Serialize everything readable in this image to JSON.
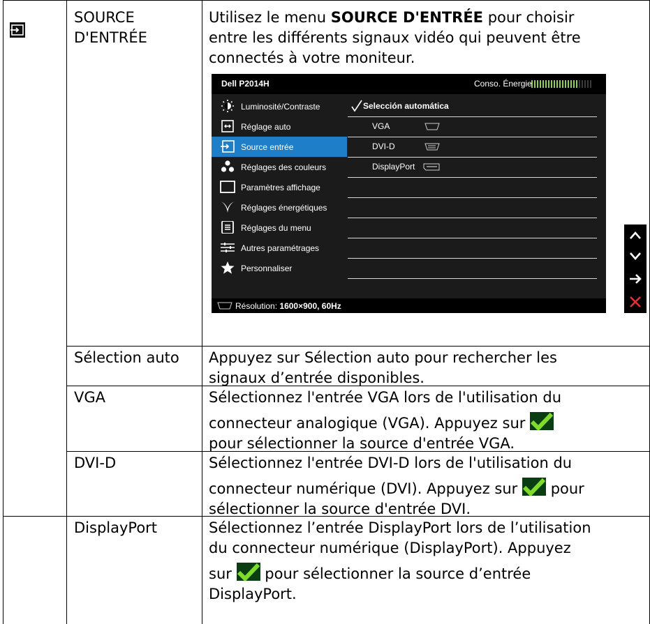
{
  "rows": [
    {
      "term": "SOURCE D'ENTRÉE",
      "desc_line1_pre": "Utilisez le menu ",
      "desc_line1_bold": "SOURCE D'ENTRÉE",
      "desc_line1_post": " pour choisir",
      "desc_line2": "entre les différents signaux vidéo qui peuvent être",
      "desc_line3": "connectés à votre moniteur."
    },
    {
      "term": "Sélection auto",
      "desc_line1": "Appuyez sur Sélection auto pour rechercher les",
      "desc_line2": "signaux d’entrée disponibles."
    },
    {
      "term": "VGA",
      "desc_line1": "Sélectionnez l'entrée VGA lors de l'utilisation du",
      "desc_line2": "connecteur analogique (VGA). Appuyez sur",
      "desc_line3": "pour sélectionner la source d'entrée VGA."
    },
    {
      "term": "DVI-D",
      "desc_line1": "Sélectionnez l'entrée DVI-D lors de l'utilisation du",
      "desc_line2_pre": "connecteur numérique (DVI). Appuyez sur",
      "desc_line2_post": "pour",
      "desc_line3": "sélectionner la source d'entrée DVI."
    },
    {
      "term": "DisplayPort",
      "desc_line1": "Sélectionnez l’entrée DisplayPort lors de l’utilisation",
      "desc_line2": "du connecteur numérique (DisplayPort). Appuyez",
      "desc_line3_pre": "sur",
      "desc_line3_post": "pour sélectionner la source d’entrée",
      "desc_line4": "DisplayPort."
    }
  ],
  "osd": {
    "model": "Dell P2014H",
    "energy_label": "Conso. Énergie",
    "menu": [
      {
        "label": "Luminosité/Contraste",
        "icon": "brightness-icon"
      },
      {
        "label": "Réglage auto",
        "icon": "auto-adjust-icon"
      },
      {
        "label": "Source entrée",
        "icon": "input-source-icon",
        "selected": true
      },
      {
        "label": "Réglages des couleurs",
        "icon": "color-icon"
      },
      {
        "label": "Paramètres affichage",
        "icon": "display-icon"
      },
      {
        "label": "Réglages énergétiques",
        "icon": "energy-icon"
      },
      {
        "label": "Réglages du menu",
        "icon": "menu-icon"
      },
      {
        "label": "Autres paramétrages",
        "icon": "other-settings-icon"
      },
      {
        "label": "Personnaliser",
        "icon": "star-icon"
      }
    ],
    "options": [
      "Selección automática",
      "VGA",
      "DVI-D",
      "DisplayPort"
    ],
    "footer_label": "Résolution:",
    "footer_value": "1600×900, 60Hz",
    "colors": {
      "selected": "#1e7ec8",
      "background": "#1b1b1b",
      "energy": "#8ed14a"
    }
  },
  "side_buttons": [
    "up-icon",
    "down-icon",
    "enter-icon",
    "exit-icon"
  ]
}
